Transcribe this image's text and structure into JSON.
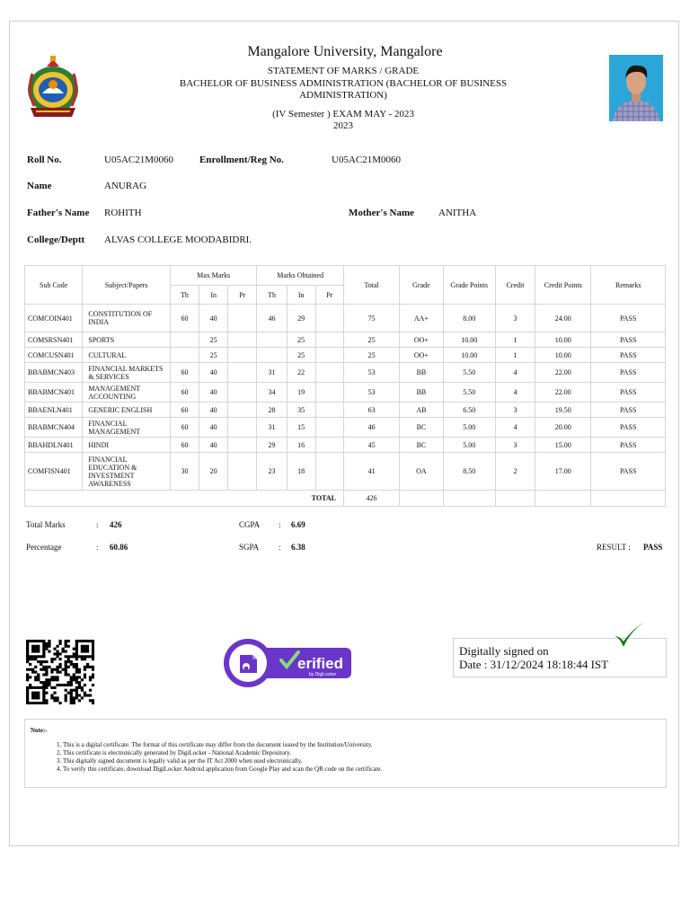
{
  "header": {
    "university": "Mangalore University, Mangalore",
    "statement": "STATEMENT OF MARKS / GRADE",
    "program_line1": "BACHELOR OF BUSINESS ADMINISTRATION (BACHELOR OF BUSINESS",
    "program_line2": "ADMINISTRATION)",
    "exam": "(IV Semester ) EXAM MAY - 2023",
    "year": "2023"
  },
  "student": {
    "roll_label": "Roll No.",
    "roll_value": "U05AC21M0060",
    "enroll_label": "Enrollment/Reg No.",
    "enroll_value": "U05AC21M0060",
    "name_label": "Name",
    "name_value": "ANURAG",
    "father_label": "Father's Name",
    "father_value": "ROHITH",
    "mother_label": "Mother's Name",
    "mother_value": "ANITHA",
    "college_label": "College/Deptt",
    "college_value": "ALVAS COLLEGE MOODABIDRI."
  },
  "table": {
    "headers": {
      "sub_code": "Sub Code",
      "subject": "Subject/Papers",
      "max_marks": "Max Marks",
      "marks_obtained": "Marks Obtained",
      "total": "Total",
      "grade": "Grade",
      "grade_points": "Grade Points",
      "credit": "Credit",
      "credit_points": "Credit Points",
      "remarks": "Remarks",
      "th": "Th",
      "in": "In",
      "pr": "Pr"
    },
    "rows": [
      {
        "code": "COMCOIN401",
        "subject": "CONSTITUTION OF INDIA",
        "max_th": "60",
        "max_in": "40",
        "max_pr": "",
        "ob_th": "46",
        "ob_in": "29",
        "ob_pr": "",
        "total": "75",
        "grade": "AA+",
        "gp": "8.00",
        "credit": "3",
        "cp": "24.00",
        "remarks": "PASS"
      },
      {
        "code": "COMSRSN401",
        "subject": "SPORTS",
        "max_th": "",
        "max_in": "25",
        "max_pr": "",
        "ob_th": "",
        "ob_in": "25",
        "ob_pr": "",
        "total": "25",
        "grade": "OO+",
        "gp": "10.00",
        "credit": "1",
        "cp": "10.00",
        "remarks": "PASS"
      },
      {
        "code": "COMCUSN401",
        "subject": "CULTURAL",
        "max_th": "",
        "max_in": "25",
        "max_pr": "",
        "ob_th": "",
        "ob_in": "25",
        "ob_pr": "",
        "total": "25",
        "grade": "OO+",
        "gp": "10.00",
        "credit": "1",
        "cp": "10.00",
        "remarks": "PASS"
      },
      {
        "code": "BBABMCN403",
        "subject": "FINANCIAL MARKETS & SERVICES",
        "max_th": "60",
        "max_in": "40",
        "max_pr": "",
        "ob_th": "31",
        "ob_in": "22",
        "ob_pr": "",
        "total": "53",
        "grade": "BB",
        "gp": "5.50",
        "credit": "4",
        "cp": "22.00",
        "remarks": "PASS"
      },
      {
        "code": "BBABMCN401",
        "subject": "MANAGEMENT ACCOUNTING",
        "max_th": "60",
        "max_in": "40",
        "max_pr": "",
        "ob_th": "34",
        "ob_in": "19",
        "ob_pr": "",
        "total": "53",
        "grade": "BB",
        "gp": "5.50",
        "credit": "4",
        "cp": "22.00",
        "remarks": "PASS"
      },
      {
        "code": "BBAENLN401",
        "subject": "GENERIC ENGLISH",
        "max_th": "60",
        "max_in": "40",
        "max_pr": "",
        "ob_th": "28",
        "ob_in": "35",
        "ob_pr": "",
        "total": "63",
        "grade": "AB",
        "gp": "6.50",
        "credit": "3",
        "cp": "19.50",
        "remarks": "PASS"
      },
      {
        "code": "BBABMCN404",
        "subject": "FINANCIAL MANAGEMENT",
        "max_th": "60",
        "max_in": "40",
        "max_pr": "",
        "ob_th": "31",
        "ob_in": "15",
        "ob_pr": "",
        "total": "46",
        "grade": "BC",
        "gp": "5.00",
        "credit": "4",
        "cp": "20.00",
        "remarks": "PASS"
      },
      {
        "code": "BBAHDLN401",
        "subject": "HINDI",
        "max_th": "60",
        "max_in": "40",
        "max_pr": "",
        "ob_th": "29",
        "ob_in": "16",
        "ob_pr": "",
        "total": "45",
        "grade": "BC",
        "gp": "5.00",
        "credit": "3",
        "cp": "15.00",
        "remarks": "PASS"
      },
      {
        "code": "COMFISN401",
        "subject": "FINANCIAL EDUCATION & INVESTMENT AWARENESS",
        "max_th": "30",
        "max_in": "20",
        "max_pr": "",
        "ob_th": "23",
        "ob_in": "18",
        "ob_pr": "",
        "total": "41",
        "grade": "OA",
        "gp": "8.50",
        "credit": "2",
        "cp": "17.00",
        "remarks": "PASS"
      }
    ],
    "total_label": "TOTAL",
    "total_value": "426"
  },
  "summary": {
    "total_marks_label": "Total Marks",
    "total_marks_value": "426",
    "cgpa_label": "CGPA",
    "cgpa_value": "6.69",
    "percentage_label": "Percentage",
    "percentage_value": "60.86",
    "sgpa_label": "SGPA",
    "sgpa_value": "6.38",
    "result_label": "RESULT :",
    "result_value": "PASS",
    "colon": ":"
  },
  "verification": {
    "badge_text": "erified",
    "badge_sub": "by DigiLocker",
    "signed_line1": "Digitally signed on",
    "signed_line2": "Date : 31/12/2024 18:18:44 IST",
    "check_color": "#0e7a0e",
    "badge_color": "#6a35c9"
  },
  "notes": {
    "title": "Note:-",
    "items": [
      "This is a digital certificate. The format of this certificate may differ from the document issued by the Institution/University.",
      "This certificate is electronically generated by DigiLocker - National Academic Depository.",
      "This digitally signed document is legally valid as per the IT Act 2000 when used electronically.",
      "To verify this certificate, download DigiLocker Android application from Google Play and scan the QR code on the certificate."
    ]
  }
}
